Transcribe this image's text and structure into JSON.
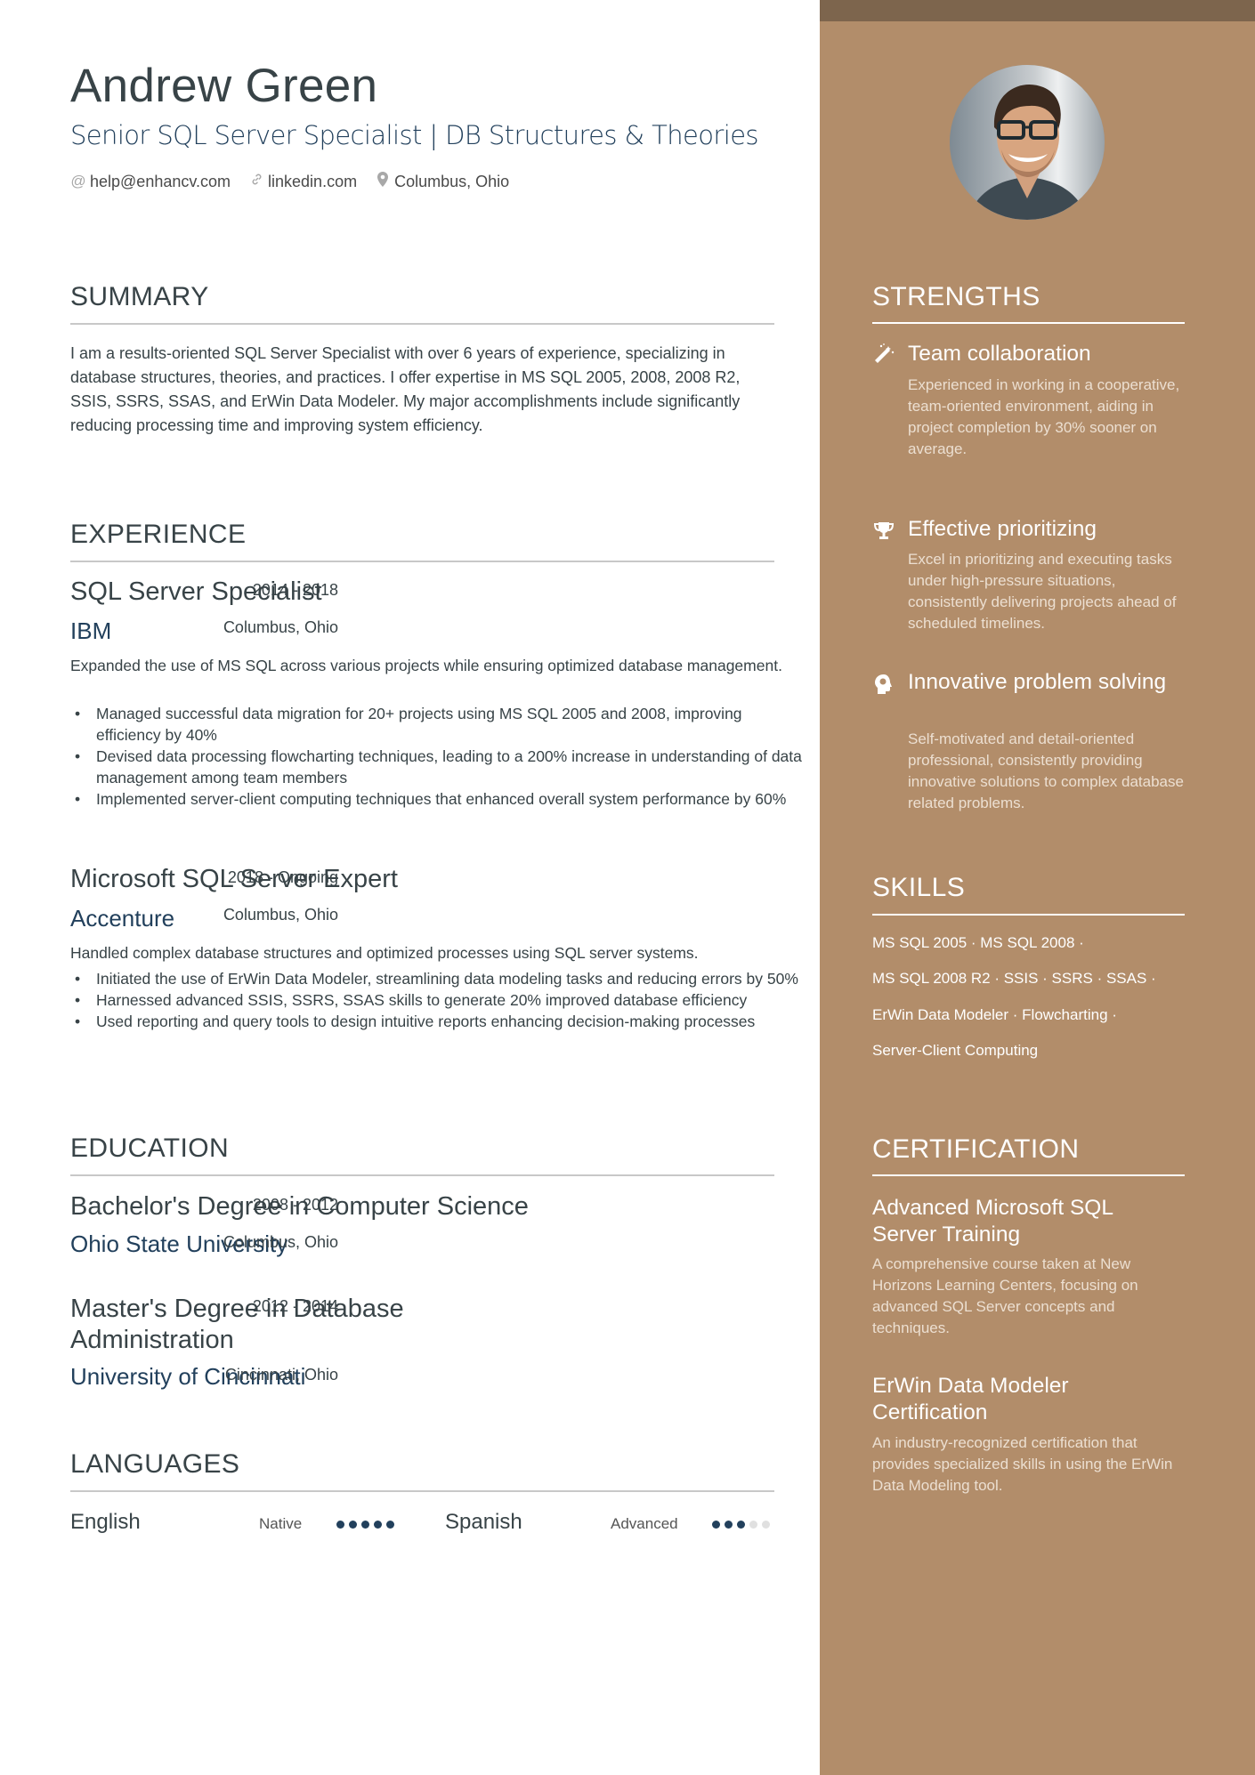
{
  "colors": {
    "sidebar": "#b28d6a",
    "sidebar_band": "#7d654d",
    "accent_navy": "#22405c",
    "text_dark": "#384347",
    "rule_gray": "#c8c8c8"
  },
  "header": {
    "name": "Andrew Green",
    "headline": "Senior SQL Server Specialist | DB Structures & Theories",
    "contacts": [
      {
        "icon": "at-icon",
        "text": "help@enhancv.com"
      },
      {
        "icon": "link-icon",
        "text": "linkedin.com"
      },
      {
        "icon": "location-pin-icon",
        "text": "Columbus, Ohio"
      }
    ]
  },
  "summary": {
    "title": "SUMMARY",
    "text": "I am a results-oriented SQL Server Specialist with over 6 years of experience, specializing in database structures, theories, and practices. I offer expertise in MS SQL 2005, 2008, 2008 R2, SSIS, SSRS, SSAS, and ErWin Data Modeler. My major accomplishments include significantly reducing processing time and improving system efficiency."
  },
  "experience": {
    "title": "EXPERIENCE",
    "jobs": [
      {
        "title": "SQL Server Specialist",
        "company": "IBM",
        "dates": "2014 - 2018",
        "location": "Columbus, Ohio",
        "description": "Expanded the use of MS SQL across various projects while ensuring optimized database management.",
        "bullets": [
          "Managed successful data migration for 20+ projects using MS SQL 2005 and 2008, improving efficiency by 40%",
          "Devised data processing flowcharting techniques, leading to a 200% increase in understanding of data management among team members",
          "Implemented server-client computing techniques that enhanced overall system performance by 60%"
        ]
      },
      {
        "title": "Microsoft SQL Server Expert",
        "company": "Accenture",
        "dates": "2018 - Ongoing",
        "location": "Columbus, Ohio",
        "description": "Handled complex database structures and optimized processes using SQL server systems.",
        "bullets": [
          "Initiated the use of ErWin Data Modeler, streamlining data modeling tasks and reducing errors by 50%",
          "Harnessed advanced SSIS, SSRS, SSAS skills to generate 20% improved database efficiency",
          "Used reporting and query tools to design intuitive reports enhancing decision-making processes"
        ]
      }
    ]
  },
  "education": {
    "title": "EDUCATION",
    "items": [
      {
        "degree": "Bachelor's Degree in Computer Science",
        "school": "Ohio State University",
        "dates": "2008 - 2012",
        "location": "Columbus, Ohio"
      },
      {
        "degree": "Master's Degree in Database Administration",
        "school": "University of Cincinnati",
        "dates": "2012 - 2014",
        "location": "Cincinnati, Ohio"
      }
    ]
  },
  "languages": {
    "title": "LANGUAGES",
    "items": [
      {
        "name": "English",
        "level": "Native",
        "rating": 5,
        "max": 5
      },
      {
        "name": "Spanish",
        "level": "Advanced",
        "rating": 3,
        "max": 5
      }
    ]
  },
  "sidebar": {
    "photo_alt": "Profile photo of Andrew Green",
    "strengths": {
      "title": "STRENGTHS",
      "items": [
        {
          "icon": "magic-wand-icon",
          "title": "Team collaboration",
          "description": "Experienced in working in a cooperative, team-oriented environment, aiding in project completion by 30% sooner on average."
        },
        {
          "icon": "trophy-icon",
          "title": "Effective prioritizing",
          "description": "Excel in prioritizing and executing tasks under high-pressure situations, consistently delivering projects ahead of scheduled timelines."
        },
        {
          "icon": "head-brain-icon",
          "title": "Innovative problem solving",
          "description": "Self-motivated and detail-oriented professional, consistently providing innovative solutions to complex database related problems."
        }
      ]
    },
    "skills": {
      "title": "SKILLS",
      "lines": [
        "MS SQL 2005 · MS SQL 2008 ·",
        "MS SQL 2008 R2 · SSIS · SSRS · SSAS ·",
        "ErWin Data Modeler · Flowcharting ·",
        "Server-Client Computing"
      ]
    },
    "certification": {
      "title": "CERTIFICATION",
      "items": [
        {
          "title": "Advanced Microsoft SQL Server Training",
          "description": "A comprehensive course taken at New Horizons Learning Centers, focusing on advanced SQL Server concepts and techniques."
        },
        {
          "title": "ErWin Data Modeler Certification",
          "description": "An industry-recognized certification that provides specialized skills in using the ErWin Data Modeling tool."
        }
      ]
    }
  }
}
